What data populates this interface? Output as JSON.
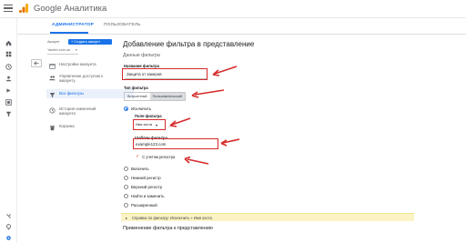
{
  "app": {
    "title": "Google Аналитика"
  },
  "tabs": {
    "admin": "АДМИНИСТРАТОР",
    "user": "ПОЛЬЗОВАТЕЛЬ"
  },
  "account": {
    "label": "Аккаунт",
    "create_button": "+ Создать аккаунт",
    "selected": "Yandex.com.ua"
  },
  "nav": {
    "items": [
      {
        "label": "Настройки аккаунта",
        "icon": "building-icon"
      },
      {
        "label": "Управление доступом к\nаккаунту",
        "icon": "people-icon"
      },
      {
        "label": "Все фильтры",
        "icon": "filter-icon"
      },
      {
        "label": "История изменений\nаккаунта",
        "icon": "history-icon"
      },
      {
        "label": "Корзина",
        "icon": "trash-icon"
      }
    ]
  },
  "form": {
    "title": "Добавление фильтра в представление",
    "section": "Данные фильтра",
    "filter_name_label": "Название фильтра",
    "filter_name_value": "Защита от хакеров",
    "filter_type_label": "Тип фильтра",
    "filter_type_options": {
      "builtin": "Встроенный",
      "custom": "Пользовательский"
    },
    "exclude_label": "Исключить",
    "filter_field_label": "Поле фильтра",
    "filter_field_value": "Имя хоста",
    "pattern_label": "Шаблон фильтра",
    "pattern_value": "example123.com",
    "case_label": "С учетом регистра",
    "other_options": [
      "Включить",
      "Нижний регистр",
      "Верхний регистр",
      "Найти и заменить",
      "Расширенный"
    ],
    "preview_text": "Справка по фильтру: Исключить » Имя хоста",
    "apply_title": "Применение фильтра к представлению"
  },
  "colors": {
    "accent": "#1a73e8",
    "annotation": "#d62b2b",
    "preview_bg": "#fbf3c4"
  }
}
